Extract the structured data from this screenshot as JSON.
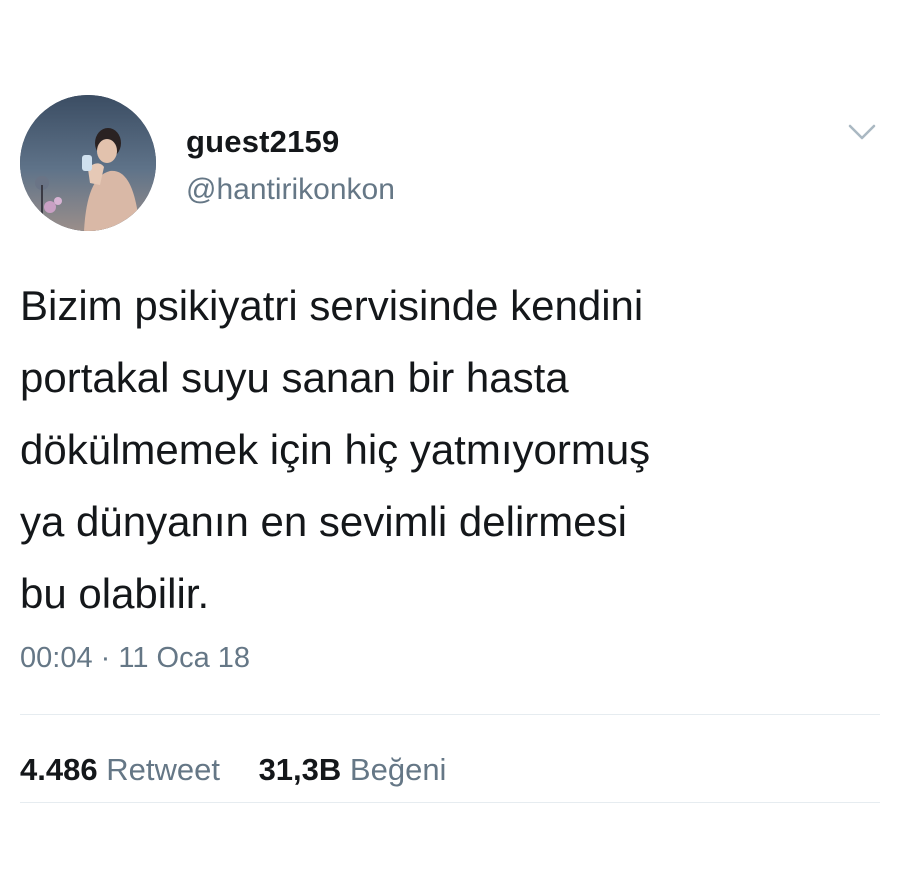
{
  "user": {
    "display_name": "guest2159",
    "handle": "@hantirikonkon"
  },
  "tweet": {
    "text": "Bizim psikiyatri servisinde kendini\nportakal suyu sanan bir hasta\ndökülmemek için hiç yatmıyormuş\nya dünyanın en sevimli delirmesi\nbu olabilir.",
    "time": "00:04",
    "separator": "·",
    "date": "11 Oca 18"
  },
  "stats": {
    "retweets": {
      "count": "4.486",
      "label": "Retweet"
    },
    "likes": {
      "count": "31,3B",
      "label": "Beğeni"
    }
  },
  "icons": {
    "menu": "chevron-down-icon",
    "avatar": "profile-photo"
  },
  "colors": {
    "text": "#14171a",
    "secondary": "#657786",
    "divider": "#e6ecf0"
  }
}
